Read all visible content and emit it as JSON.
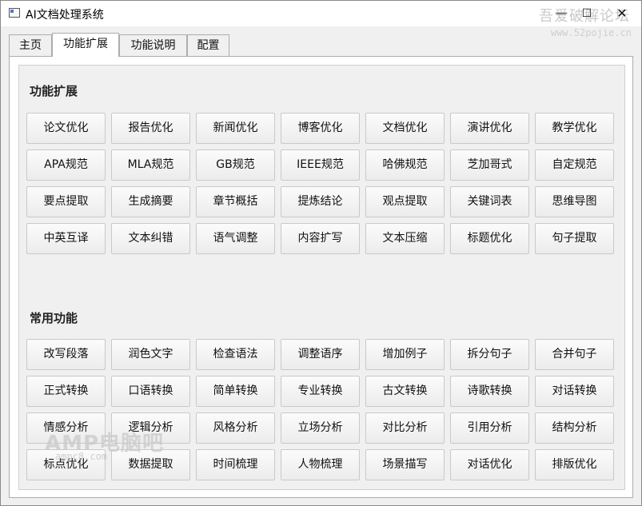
{
  "window": {
    "title": "AI文档处理系统",
    "controls": {
      "minimize": "—",
      "maximize": "☐",
      "close": "✕"
    }
  },
  "watermarks": {
    "top_title": "吾爱破解论坛",
    "top_url": "www.52pojie.cn",
    "bottom_title": "AMP电脑吧",
    "bottom_url": "ampc8.com"
  },
  "tabs": [
    {
      "label": "主页"
    },
    {
      "label": "功能扩展"
    },
    {
      "label": "功能说明"
    },
    {
      "label": "配置"
    }
  ],
  "active_tab": "功能扩展",
  "sections": [
    {
      "title": "功能扩展",
      "buttons": [
        "论文优化",
        "报告优化",
        "新闻优化",
        "博客优化",
        "文档优化",
        "演讲优化",
        "教学优化",
        "APA规范",
        "MLA规范",
        "GB规范",
        "IEEE规范",
        "哈佛规范",
        "芝加哥式",
        "自定规范",
        "要点提取",
        "生成摘要",
        "章节概括",
        "提炼结论",
        "观点提取",
        "关键词表",
        "思维导图",
        "中英互译",
        "文本纠错",
        "语气调整",
        "内容扩写",
        "文本压缩",
        "标题优化",
        "句子提取"
      ]
    },
    {
      "title": "常用功能",
      "buttons": [
        "改写段落",
        "润色文字",
        "检查语法",
        "调整语序",
        "增加例子",
        "拆分句子",
        "合并句子",
        "正式转换",
        "口语转换",
        "简单转换",
        "专业转换",
        "古文转换",
        "诗歌转换",
        "对话转换",
        "情感分析",
        "逻辑分析",
        "风格分析",
        "立场分析",
        "对比分析",
        "引用分析",
        "结构分析",
        "标点优化",
        "数据提取",
        "时间梳理",
        "人物梳理",
        "场景描写",
        "对话优化",
        "排版优化"
      ]
    }
  ]
}
